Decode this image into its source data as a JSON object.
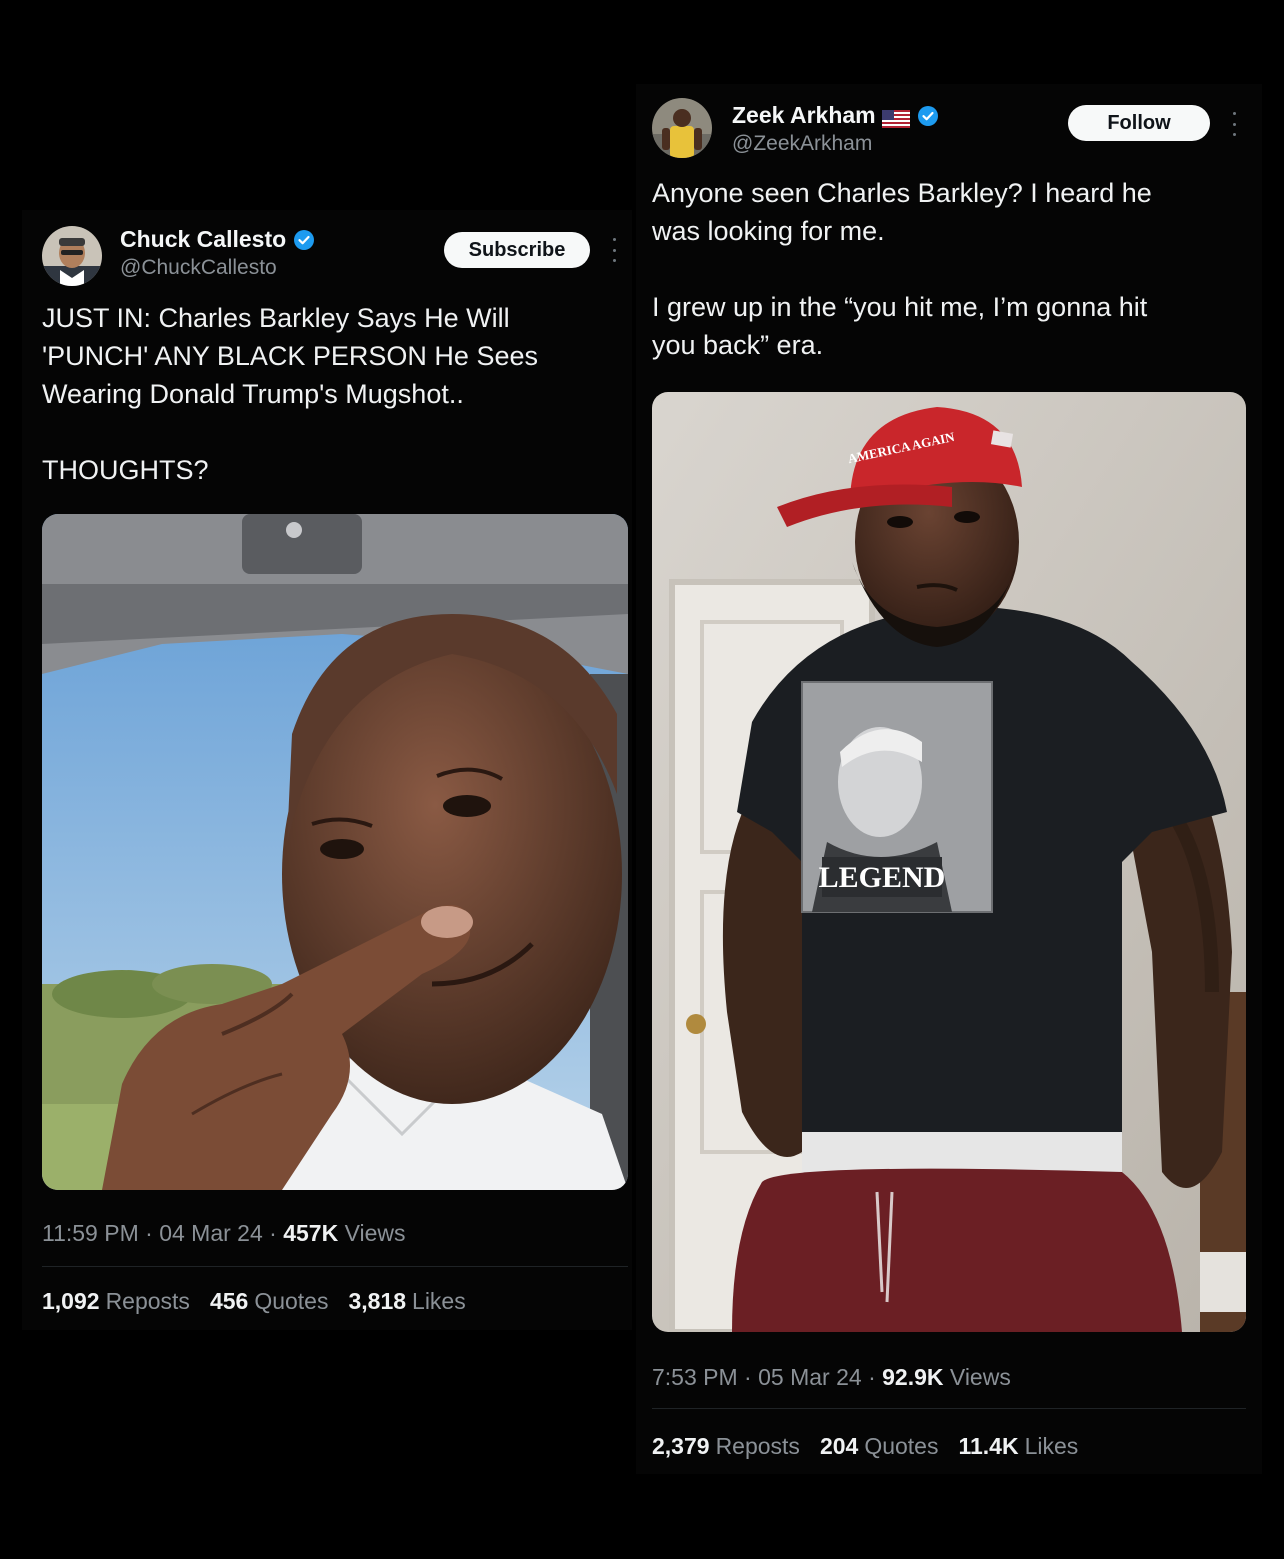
{
  "left_tweet": {
    "display_name": "Chuck Callesto",
    "handle": "@ChuckCallesto",
    "subscribe_label": "Subscribe",
    "text": "JUST IN: Charles Barkley Says He Will\n'PUNCH' ANY BLACK PERSON He Sees\nWearing Donald Trump's Mugshot..\n\nTHOUGHTS?",
    "time": "11:59 PM",
    "date": "04 Mar 24",
    "views_count": "457K",
    "views_label": "Views",
    "reposts_count": "1,092",
    "reposts_label": "Reposts",
    "quotes_count": "456",
    "quotes_label": "Quotes",
    "likes_count": "3,818",
    "likes_label": "Likes"
  },
  "right_tweet": {
    "display_name": "Zeek Arkham",
    "handle": "@ZeekArkham",
    "follow_label": "Follow",
    "text": "Anyone seen Charles Barkley? I heard he\nwas looking for me.\n\nI grew up in the “you hit me, I’m gonna hit\nyou back” era.",
    "cap_text": "AMERICA AGAIN",
    "shirt_text": "LEGEND",
    "time": "7:53 PM",
    "date": "05 Mar 24",
    "views_count": "92.9K",
    "views_label": "Views",
    "reposts_count": "2,379",
    "reposts_label": "Reposts",
    "quotes_count": "204",
    "quotes_label": "Quotes",
    "likes_count": "11.4K",
    "likes_label": "Likes"
  },
  "colors": {
    "background": "#000000",
    "verified_blue": "#1d9bf0",
    "text_primary": "#f0f2f3",
    "text_secondary": "#8b9197"
  },
  "icons": [
    "verified-badge-icon",
    "us-flag-icon",
    "more-options-icon"
  ]
}
